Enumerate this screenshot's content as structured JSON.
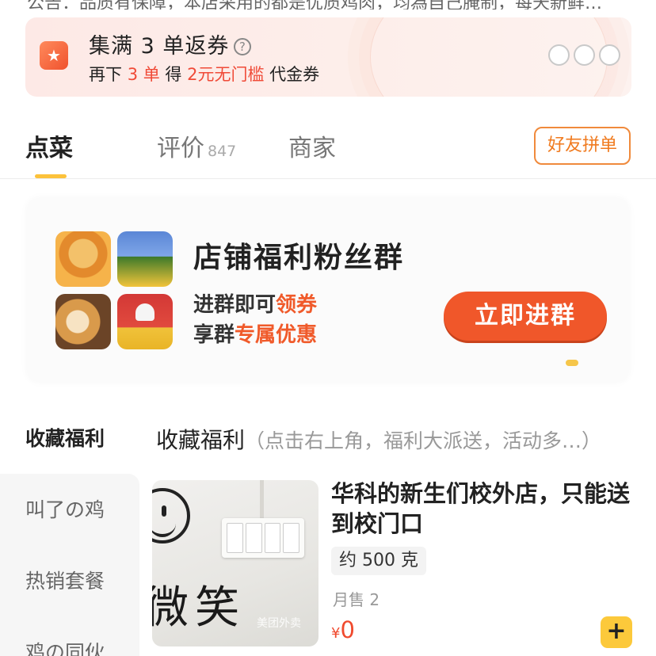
{
  "notice": {
    "text": "公告：品质有保障，本店采用的都是优质鸡肉，均為自己腌制，每天新鲜…"
  },
  "coupon": {
    "title": "集满 3 单返券",
    "line_prefix": "再下",
    "orders": "3 单",
    "get": "得",
    "reward": "2元无门槛",
    "suffix": "代金券",
    "help_icon": "question-circle-icon",
    "badge_icon": "star-badge-icon",
    "progress": {
      "done": 0,
      "total": 3
    },
    "accent": "#f04a37"
  },
  "tabs": {
    "items": [
      {
        "label": "点菜",
        "count": ""
      },
      {
        "label": "评价",
        "count": "847"
      },
      {
        "label": "商家",
        "count": ""
      }
    ],
    "active": "点菜",
    "group_order": "好友拼单",
    "accent": "#fcc23b"
  },
  "banner": {
    "title": "店铺福利粉丝群",
    "line1_prefix": "进群即可",
    "line1_hl": "领券",
    "line2_prefix": "享群",
    "line2_hl": "专属优惠",
    "join": "立即进群",
    "accent": "#f0572a"
  },
  "menu": {
    "active_category": "收藏福利",
    "section_name": "收藏福利",
    "section_desc": "（点击右上角，福利大派送，活动多…）",
    "categories": [
      "叫了の鸡",
      "热销套餐",
      "鸡の同伙"
    ]
  },
  "product": {
    "name": "华科的新生们校外店，只能送到校门口",
    "spec": "约 500 克",
    "sales": "月售 2",
    "currency": "¥",
    "price": "0",
    "image_text": "微笑",
    "watermark": "美团外卖",
    "add_icon": "plus-icon"
  }
}
